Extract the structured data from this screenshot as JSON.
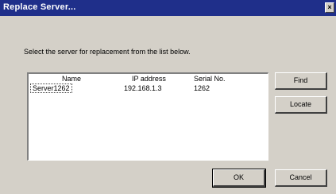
{
  "window": {
    "title": "Replace Server...",
    "close_label": "×"
  },
  "dialog": {
    "instruction": "Select the server for replacement from the list below."
  },
  "list": {
    "columns": [
      "Name",
      "IP address",
      "Serial No."
    ],
    "rows": [
      {
        "name": "Server1262",
        "ip": "192.168.1.3",
        "serial": "1262"
      }
    ]
  },
  "buttons": {
    "find": "Find",
    "locate": "Locate",
    "ok": "OK",
    "cancel": "Cancel"
  }
}
